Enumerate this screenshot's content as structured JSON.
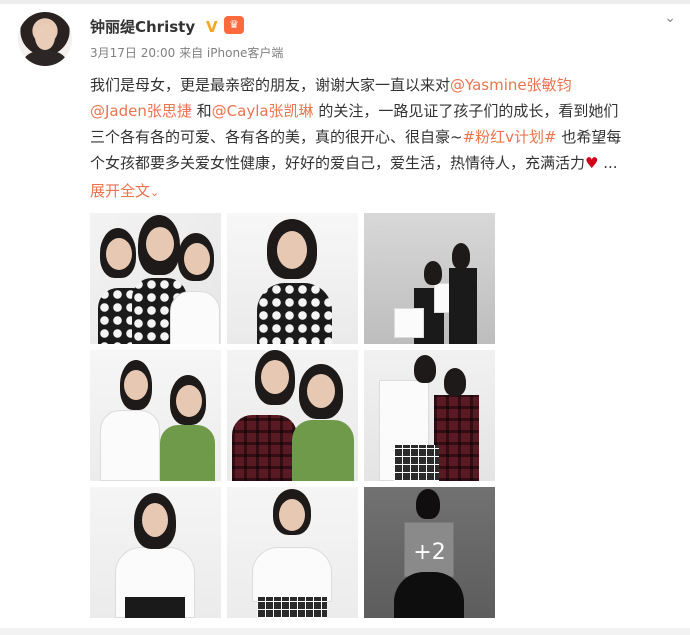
{
  "post": {
    "author": "钟丽缇Christy",
    "verified_badge": "V",
    "crown_badge": "♛",
    "menu_icon": "chevron-down-icon",
    "meta": "3月17日 20:00 来自 iPhone客户端",
    "lines": [
      {
        "a": "我们是母女，更是最亲密的朋友，谢谢大家一直以来对",
        "m1": "@Yasmine张敏钧"
      },
      {
        "m2": "@Jaden张思捷",
        "b": " 和",
        "m3": "@Cayla张凯琳",
        "c": " 的关注，一路见证了孩子们的成长，看到她们"
      },
      {
        "d": "三个各有各的可爱、各有各的美，真的很开心、很自豪~",
        "topic": "#粉红v计划#",
        "e": " 也希望每"
      },
      {
        "f": "个女孩都要多关爱女性健康，好好的爱自己，爱生活，热情待人，充满活力",
        "heart": "♥",
        "g": " ..."
      }
    ],
    "expand_label": "展开全文",
    "expand_caret": "⌄",
    "more_photos": "+2"
  },
  "colors": {
    "link": "#eb7350",
    "text": "#333333",
    "meta": "#808080",
    "verified": "#f5a623",
    "heart": "#d0021b"
  }
}
